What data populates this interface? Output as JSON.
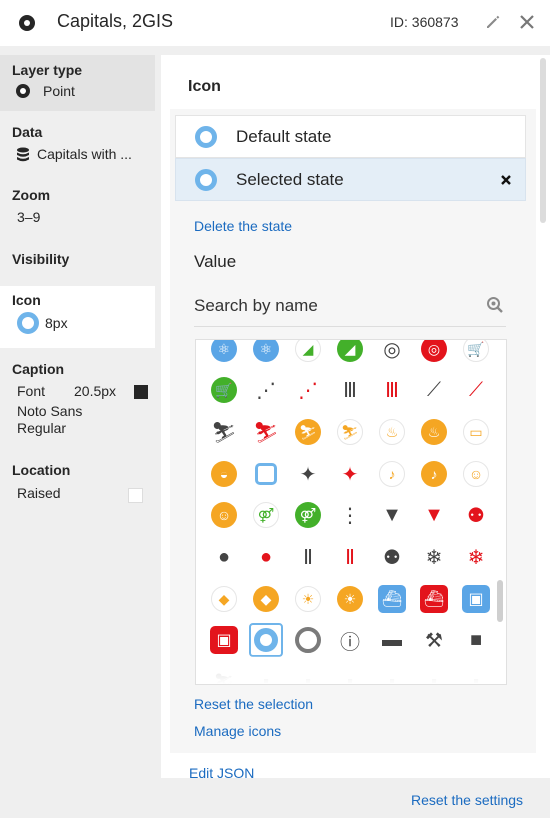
{
  "header": {
    "title": "Capitals, 2GIS",
    "id_label": "ID: 360873"
  },
  "sidebar": {
    "layer_type": {
      "title": "Layer type",
      "value": "Point"
    },
    "data": {
      "title": "Data",
      "value": "Capitals with ..."
    },
    "zoom": {
      "title": "Zoom",
      "value": "3–9"
    },
    "visibility": {
      "title": "Visibility"
    },
    "icon": {
      "title": "Icon",
      "value": "8px"
    },
    "caption": {
      "title": "Caption",
      "font_label": "Font",
      "font_size": "20.5px",
      "font_name": "Noto Sans Regular",
      "font_color": "#262626"
    },
    "location": {
      "title": "Location",
      "value": "Raised"
    }
  },
  "main": {
    "title": "Icon",
    "states": [
      {
        "label": "Default state"
      },
      {
        "label": "Selected state"
      }
    ],
    "delete_state": "Delete the state",
    "value_label": "Value",
    "search_placeholder": "Search by name",
    "reset_selection": "Reset the selection",
    "manage_icons": "Manage icons",
    "edit_json": "Edit JSON",
    "reset_settings": "Reset the settings"
  },
  "colors": {
    "accent": "#6fb4ea",
    "link": "#1b6bc0",
    "green": "#43b02a",
    "red": "#e3141c",
    "orange": "#f5a623",
    "blue": "#5aa5e6",
    "gray": "#333333"
  },
  "icons": [
    [
      "atom-blue-light",
      "atom-blue",
      "shoe-green-outline",
      "shoe-green",
      "target-gray",
      "target-red",
      "cart-green-outline"
    ],
    [
      "cart-green",
      "shower-gray",
      "shower-red",
      "column-gray",
      "column-red",
      "skateboard-gray",
      "skateboard-red"
    ],
    [
      "skier-gray",
      "skier-red",
      "skier-orange",
      "skier-orange-outline",
      "fountain-orange-outline",
      "fountain-orange",
      "taxi-orange-outline"
    ],
    [
      "toilet-orange",
      "square-blue-outline",
      "spray-gray",
      "spray-red",
      "torch-orange-outline",
      "torch-orange",
      "masks-orange-outline"
    ],
    [
      "masks-orange",
      "restroom-green-outline",
      "restroom-green",
      "traffic-light-gray",
      "trash-gray",
      "trash-red",
      "people-red"
    ],
    [
      "drop-gray",
      "drop-red",
      "aqueduct-gray",
      "aqueduct-red",
      "people-gray",
      "snowflake-gray",
      "snowflake-red"
    ],
    [
      "diamond-orange-outline",
      "diamond-orange",
      "lion-orange-outline",
      "lion-orange",
      "ship-blue",
      "ship-red",
      "train-blue"
    ],
    [
      "train-red",
      "circle-blue-selected",
      "circle-gray",
      "info-person-gray",
      "atm-gray",
      "luggage-cart-gray",
      "suitcase-gray"
    ],
    [
      "skier-faded",
      "building-faded",
      "bus-faded",
      "car-faded",
      "bed-faded",
      "ferris-faded",
      "bus2-faded"
    ]
  ]
}
